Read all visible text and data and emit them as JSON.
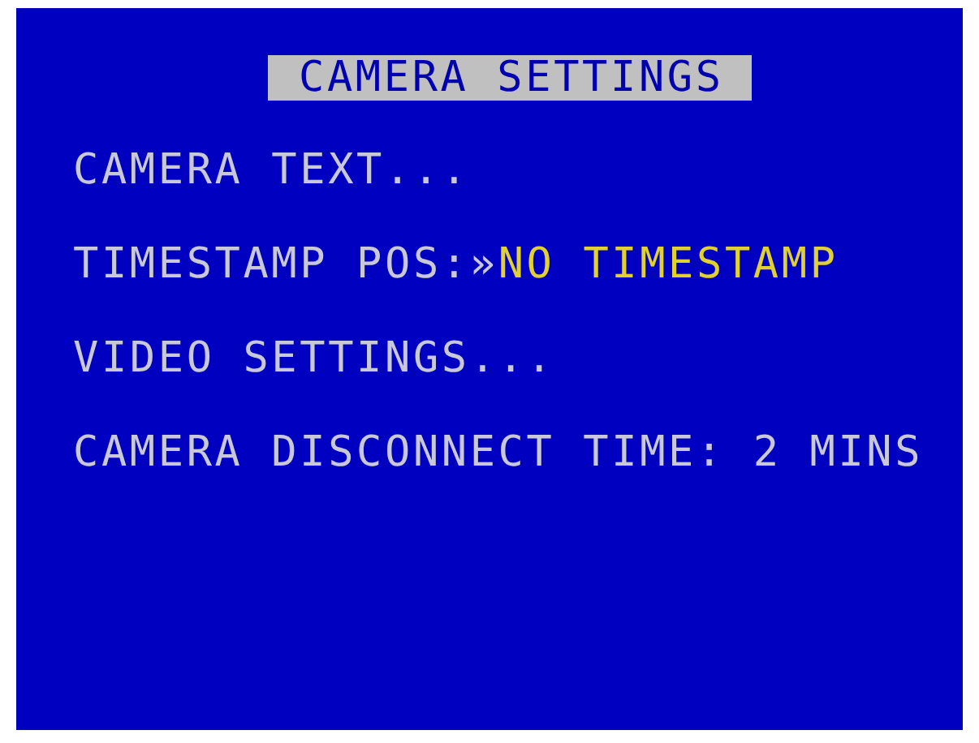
{
  "title": "CAMERA SETTINGS",
  "items": [
    {
      "kind": "submenu",
      "label": "CAMERA TEXT..."
    },
    {
      "kind": "option",
      "label": "TIMESTAMP POS:",
      "marker": "»",
      "value": "NO TIMESTAMP",
      "selected": true
    },
    {
      "kind": "submenu",
      "label": "VIDEO SETTINGS..."
    },
    {
      "kind": "option",
      "label": "CAMERA DISCONNECT TIME:",
      "value": "2 MINS",
      "selected": false
    }
  ]
}
